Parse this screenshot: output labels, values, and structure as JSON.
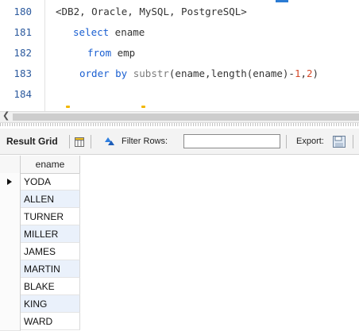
{
  "editor": {
    "lines": [
      {
        "num": "180",
        "parts": [
          {
            "t": "<DB2, Oracle, MySQL, PostgreSQL>",
            "c": "pn"
          }
        ]
      },
      {
        "num": "181",
        "parts": [
          {
            "t": "select",
            "c": "kw"
          },
          {
            "t": " ename",
            "c": "pn"
          }
        ]
      },
      {
        "num": "182",
        "parts": [
          {
            "t": "from",
            "c": "kw"
          },
          {
            "t": " emp",
            "c": "pn"
          }
        ]
      },
      {
        "num": "183",
        "parts": [
          {
            "t": "order by",
            "c": "kw"
          },
          {
            "t": " substr",
            "c": "fn"
          },
          {
            "t": "(ename,length(ename)-",
            "c": "pn"
          },
          {
            "t": "1",
            "c": "num"
          },
          {
            "t": ",",
            "c": "pn"
          },
          {
            "t": "2",
            "c": "num"
          },
          {
            "t": ")",
            "c": "pn"
          }
        ]
      },
      {
        "num": "184",
        "parts": []
      }
    ]
  },
  "toolbar": {
    "result_grid_label": "Result Grid",
    "filter_rows_label": "Filter Rows:",
    "filter_value": "",
    "export_label": "Export:"
  },
  "grid": {
    "column": "ename",
    "rows": [
      "YODA",
      "ALLEN",
      "TURNER",
      "MILLER",
      "JAMES",
      "MARTIN",
      "BLAKE",
      "KING",
      "WARD"
    ],
    "selected_row_index": 0
  },
  "colors": {
    "keyword": "#1a5fd1",
    "line_number": "#2c5a9e",
    "number_literal": "#d44a2a",
    "row_alt": "#eaf1fb"
  }
}
